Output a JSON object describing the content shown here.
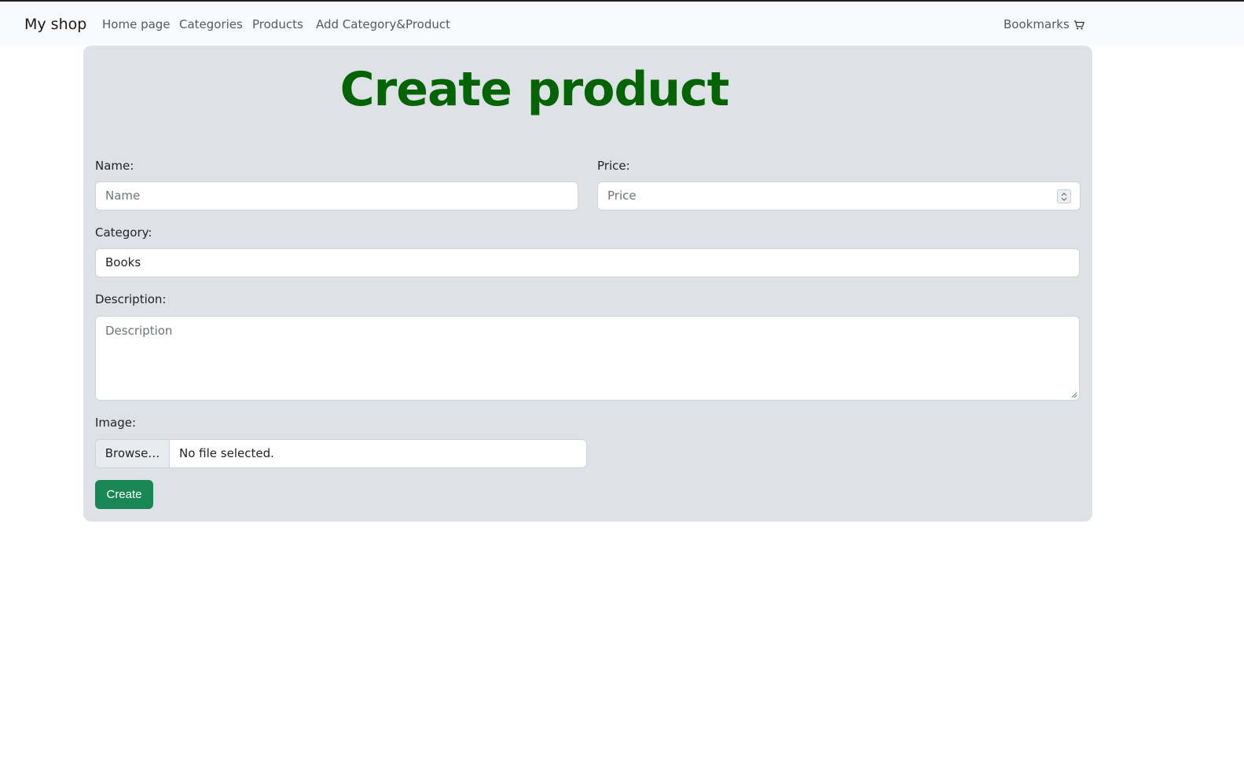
{
  "navbar": {
    "brand": "My shop",
    "links": [
      "Home page",
      "Categories",
      "Products",
      "Add Category&Product"
    ],
    "bookmarks_label": "Bookmarks",
    "bookmarks_icon": "cart-icon"
  },
  "form": {
    "title": "Create product",
    "name": {
      "label": "Name:",
      "placeholder": "Name",
      "value": ""
    },
    "price": {
      "label": "Price:",
      "placeholder": "Price",
      "value": ""
    },
    "category": {
      "label": "Category:",
      "selected": "Books"
    },
    "description": {
      "label": "Description:",
      "placeholder": "Description",
      "value": ""
    },
    "image": {
      "label": "Image:",
      "button_label": "Browse…",
      "status": "No file selected."
    },
    "submit_label": "Create"
  },
  "colors": {
    "title": "#046404",
    "card_background": "#dee2e6",
    "create_button": "#198754",
    "navbar_background": "#f8f9fa"
  }
}
